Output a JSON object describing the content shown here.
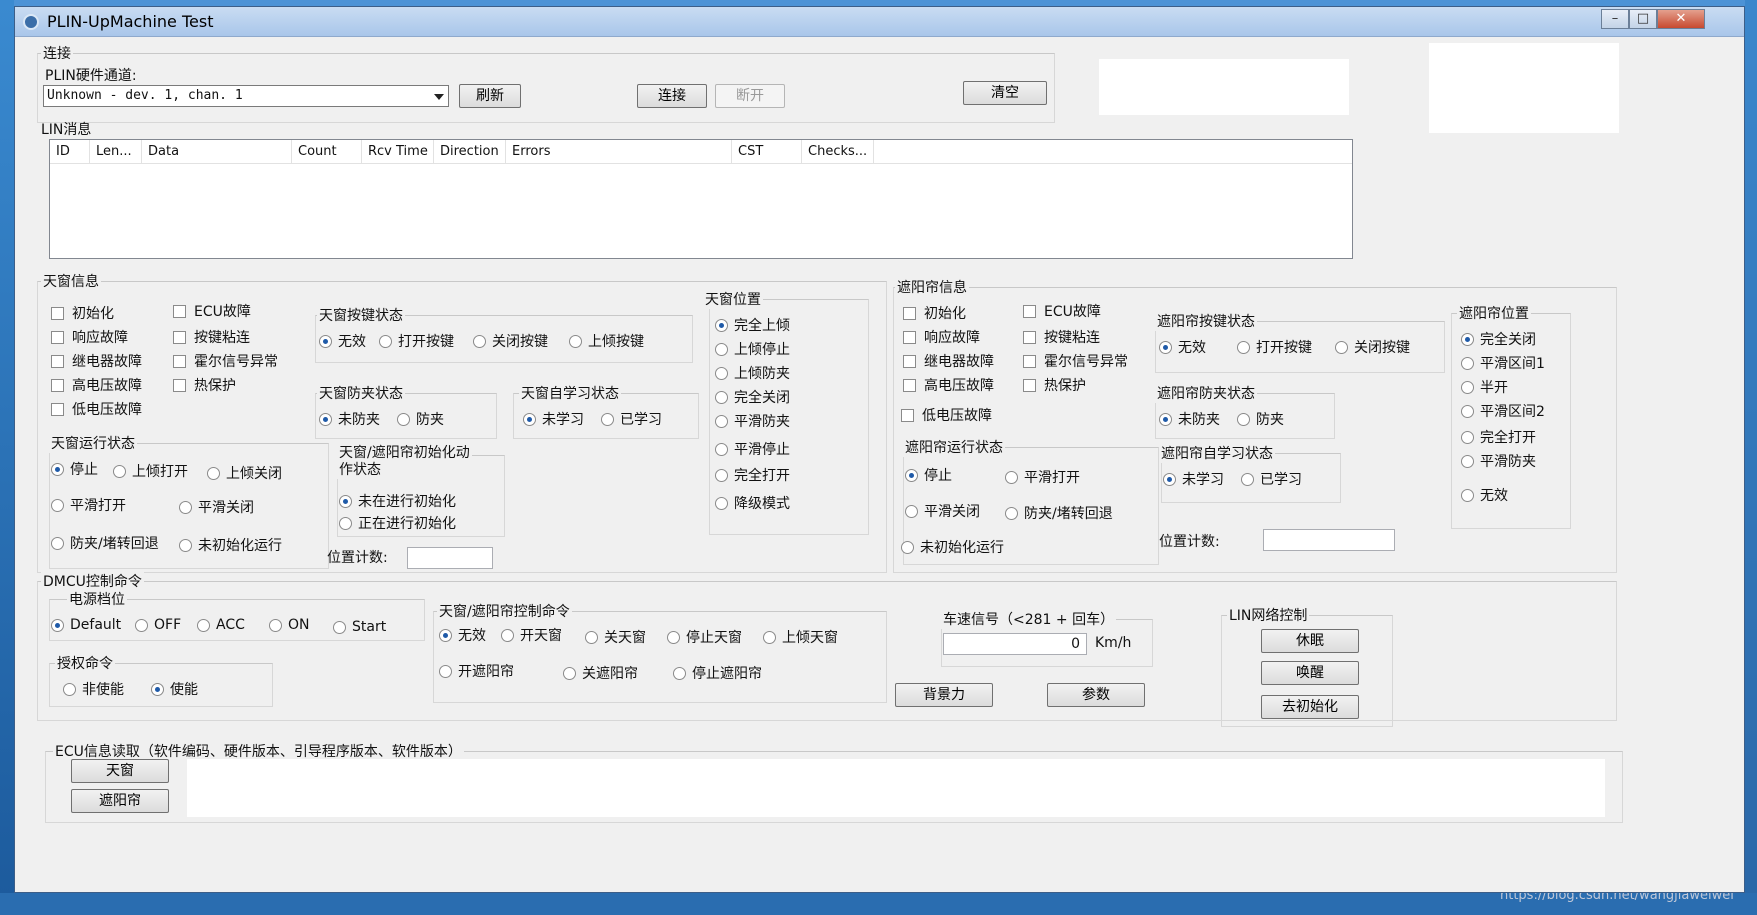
{
  "window": {
    "title": "PLIN-UpMachine Test"
  },
  "connect": {
    "group_label": "连接",
    "channel_label": "PLIN硬件通道:",
    "channel_value": "Unknown - dev. 1, chan. 1",
    "refresh": "刷新",
    "connect": "连接",
    "disconnect": "断开",
    "clear": "清空"
  },
  "lin_messages": {
    "label": "LIN消息",
    "columns": [
      "ID",
      "Len...",
      "Data",
      "Count",
      "Rcv Time",
      "Direction",
      "Errors",
      "CST",
      "Checks..."
    ]
  },
  "sunroof_info": {
    "label": "天窗信息",
    "faults_left": [
      "初始化",
      "响应故障",
      "继电器故障",
      "高电压故障",
      "低电压故障"
    ],
    "faults_right": [
      "ECU故障",
      "按键粘连",
      "霍尔信号异常",
      "热保护"
    ],
    "key_state": {
      "label": "天窗按键状态",
      "options": [
        "无效",
        "打开按键",
        "关闭按键",
        "上倾按键"
      ]
    },
    "pinch_state": {
      "label": "天窗防夹状态",
      "options": [
        "未防夹",
        "防夹"
      ]
    },
    "learn_state": {
      "label": "天窗自学习状态",
      "options": [
        "未学习",
        "已学习"
      ]
    },
    "run_state": {
      "label": "天窗运行状态",
      "options": [
        "停止",
        "上倾打开",
        "上倾关闭",
        "平滑打开",
        "平滑关闭",
        "防夹/堵转回退",
        "未初始化运行"
      ]
    },
    "init_state": {
      "label_line1": "天窗/遮阳帘初始化动",
      "label_line2": "作状态",
      "options": [
        "未在进行初始化",
        "正在进行初始化"
      ]
    },
    "position_count": "位置计数:",
    "position": {
      "label": "天窗位置",
      "options": [
        "完全上倾",
        "上倾停止",
        "上倾防夹",
        "完全关闭",
        "平滑防夹",
        "平滑停止",
        "完全打开",
        "降级模式"
      ]
    }
  },
  "shade_info": {
    "label": "遮阳帘信息",
    "faults_left": [
      "初始化",
      "响应故障",
      "继电器故障",
      "高电压故障",
      "低电压故障"
    ],
    "faults_right": [
      "ECU故障",
      "按键粘连",
      "霍尔信号异常",
      "热保护"
    ],
    "key_state": {
      "label": "遮阳帘按键状态",
      "options": [
        "无效",
        "打开按键",
        "关闭按键"
      ]
    },
    "pinch_state": {
      "label": "遮阳帘防夹状态",
      "options": [
        "未防夹",
        "防夹"
      ]
    },
    "learn_state": {
      "label": "遮阳帘自学习状态",
      "options": [
        "未学习",
        "已学习"
      ]
    },
    "run_state": {
      "label": "遮阳帘运行状态",
      "options": [
        "停止",
        "平滑打开",
        "平滑关闭",
        "防夹/堵转回退",
        "未初始化运行"
      ]
    },
    "position_count": "位置计数:",
    "position": {
      "label": "遮阳帘位置",
      "options": [
        "完全关闭",
        "平滑区间1",
        "半开",
        "平滑区间2",
        "完全打开",
        "平滑防夹",
        "无效"
      ]
    }
  },
  "dmcu": {
    "label": "DMCU控制命令",
    "power": {
      "label": "电源档位",
      "options": [
        "Default",
        "OFF",
        "ACC",
        "ON",
        "Start"
      ]
    },
    "auth": {
      "label": "授权命令",
      "options": [
        "非使能",
        "使能"
      ]
    },
    "control": {
      "label": "天窗/遮阳帘控制命令",
      "options": [
        "无效",
        "开天窗",
        "关天窗",
        "停止天窗",
        "上倾天窗",
        "开遮阳帘",
        "关遮阳帘",
        "停止遮阳帘"
      ]
    },
    "speed": {
      "label": "车速信号（<281 + 回车）",
      "value": "0",
      "unit": "Km/h"
    },
    "backlight": "背景力",
    "params": "参数",
    "lin_net": {
      "label": "LIN网络控制",
      "sleep": "休眠",
      "wake": "唤醒",
      "deinit": "去初始化"
    }
  },
  "ecu_read": {
    "label": "ECU信息读取（软件编码、硬件版本、引导程序版本、软件版本）",
    "sunroof": "天窗",
    "shade": "遮阳帘"
  },
  "watermark": "https://blog.csdn.net/wangjiaweiwei"
}
